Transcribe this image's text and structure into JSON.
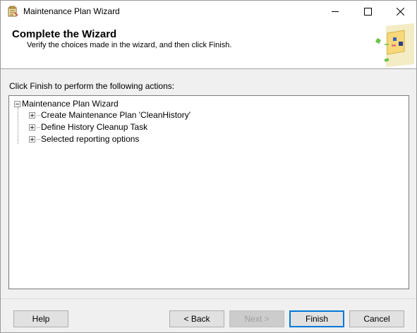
{
  "window": {
    "title": "Maintenance Plan Wizard",
    "minimize_icon": "minimize-icon",
    "maximize_icon": "maximize-icon",
    "close_icon": "close-icon"
  },
  "header": {
    "title": "Complete the Wizard",
    "subtitle": "Verify the choices made in the wizard, and then click Finish."
  },
  "main": {
    "instruction": "Click Finish to perform the following actions:",
    "tree": {
      "root": {
        "label": "Maintenance Plan Wizard",
        "expanded": true
      },
      "children": [
        {
          "label": "Create Maintenance Plan 'CleanHistory'",
          "expanded": false
        },
        {
          "label": "Define History Cleanup Task",
          "expanded": false
        },
        {
          "label": "Selected reporting options",
          "expanded": false
        }
      ]
    }
  },
  "footer": {
    "help": "Help",
    "back": "< Back",
    "next": "Next >",
    "finish": "Finish",
    "cancel": "Cancel"
  },
  "colors": {
    "accent": "#0078d7",
    "panel": "#f0f0f0",
    "button": "#e1e1e1"
  }
}
